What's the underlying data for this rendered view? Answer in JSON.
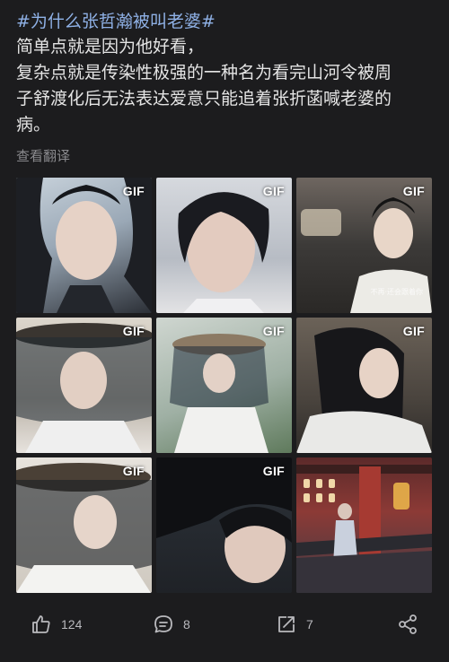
{
  "post": {
    "hashtag": "#为什么张哲瀚被叫老婆#",
    "lines": [
      "简单点就是因为他好看，",
      "复杂点就是传染性极强的一种名为看完山河令被周",
      "子舒渡化后无法表达爱意只能追着张折菡喊老婆的",
      "病。"
    ],
    "translate_link": "查看翻译"
  },
  "images": [
    {
      "badge": "GIF",
      "watermark": ""
    },
    {
      "badge": "GIF",
      "watermark": ""
    },
    {
      "badge": "GIF",
      "watermark": "不再·还会跟着你"
    },
    {
      "badge": "GIF",
      "watermark": ""
    },
    {
      "badge": "GIF",
      "watermark": ""
    },
    {
      "badge": "GIF",
      "watermark": ""
    },
    {
      "badge": "GIF",
      "watermark": ""
    },
    {
      "badge": "GIF",
      "watermark": ""
    },
    {
      "badge": "",
      "watermark": ""
    }
  ],
  "actions": {
    "like": {
      "icon": "thumbs-up-icon",
      "count": "124"
    },
    "comment": {
      "icon": "comment-icon",
      "count": "8"
    },
    "repost": {
      "icon": "share-arrow-icon",
      "count": "7"
    },
    "share": {
      "icon": "share-nodes-icon",
      "count": ""
    }
  },
  "colors": {
    "background": "#1c1c1e",
    "hashtag": "#8fb1e6",
    "muted": "#8a8a8e"
  }
}
